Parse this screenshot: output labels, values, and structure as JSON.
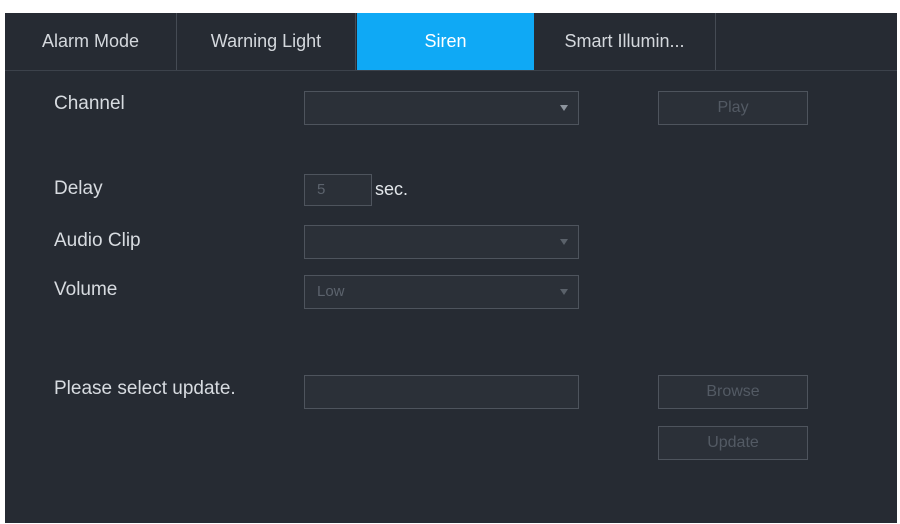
{
  "tabs": [
    {
      "label": "Alarm Mode",
      "active": false
    },
    {
      "label": "Warning Light",
      "active": false
    },
    {
      "label": "Siren",
      "active": true
    },
    {
      "label": "Smart Illumin...",
      "active": false
    }
  ],
  "form": {
    "channel": {
      "label": "Channel",
      "value": ""
    },
    "play_button": "Play",
    "delay": {
      "label": "Delay",
      "value": "5",
      "unit": "sec."
    },
    "audio_clip": {
      "label": "Audio Clip",
      "value": ""
    },
    "volume": {
      "label": "Volume",
      "value": "Low"
    },
    "update": {
      "label": "Please select update.",
      "value": ""
    },
    "browse_button": "Browse",
    "update_button": "Update"
  },
  "colors": {
    "panel_background": "#262b33",
    "active_tab": "#0fa9f5",
    "field_border": "#4e545d"
  }
}
